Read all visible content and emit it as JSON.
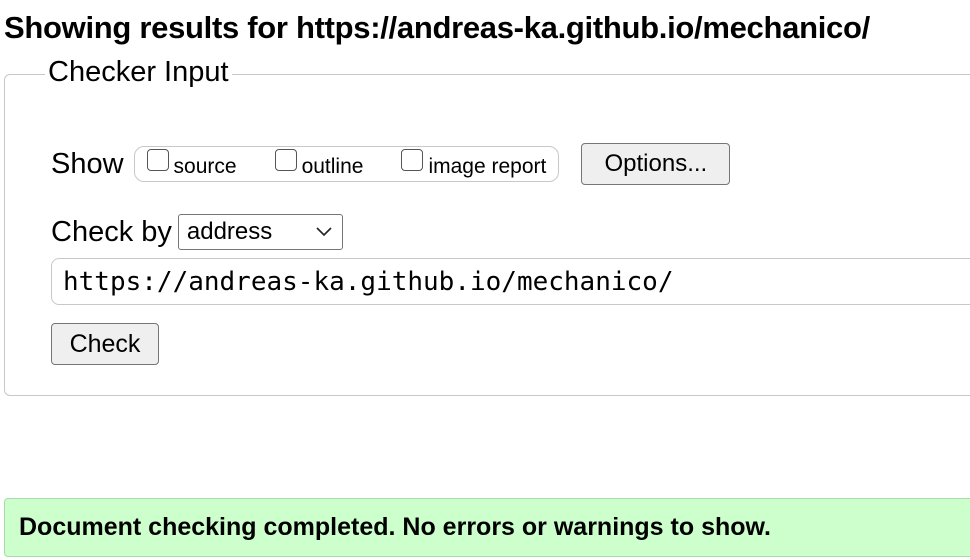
{
  "heading": "Showing results for https://andreas-ka.github.io/mechanico/",
  "checker": {
    "legend": "Checker Input",
    "show_label": "Show",
    "options": [
      {
        "label": "source",
        "checked": false
      },
      {
        "label": "outline",
        "checked": false
      },
      {
        "label": "image report",
        "checked": false
      }
    ],
    "options_button": "Options...",
    "checkby_label": "Check by",
    "checkby_selected": "address",
    "url_value": "https://andreas-ka.github.io/mechanico/",
    "check_button": "Check"
  },
  "status": {
    "message": "Document checking completed. No errors or warnings to show.",
    "color": "#ccffcc"
  }
}
